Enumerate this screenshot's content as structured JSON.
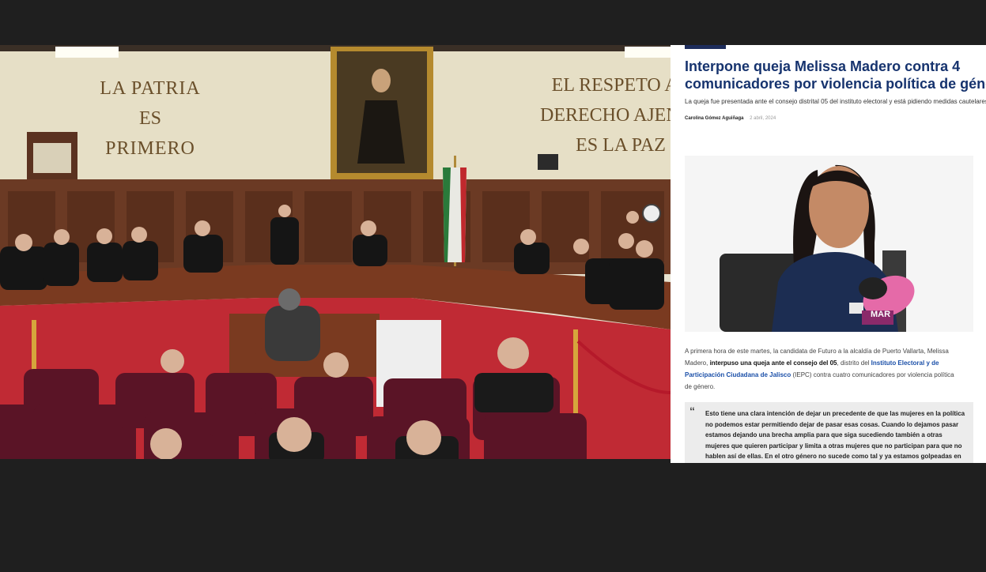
{
  "courtroom_image": {
    "wall_left": [
      "LA PATRIA",
      "ES",
      "PRIMERO"
    ],
    "wall_right": [
      "EL RESPETO AL",
      "DERECHO AJENO",
      "ES LA PAZ"
    ]
  },
  "article": {
    "headline_line1": "Interpone queja Melissa Madero contra 4",
    "headline_line2": "comunicadores por violencia política de género",
    "subtitle": "La queja fue presentada ante el consejo distrital 05 del instituto electoral y está pidiendo medidas cautelares",
    "author": "Carolina Gómez Aguiñaga",
    "date": "2 abril, 2024",
    "photo": {
      "mic_label": "MAR"
    },
    "body": {
      "p1": "A primera hora de este martes, la candidata de Futuro a la alcaldía de Puerto Vallarta, Melissa Madero, ",
      "p1_bold": "interpuso una queja ante el consejo del 05",
      "p1_mid": ", distrito del ",
      "p1_link": "Instituto Electoral y de Participación Ciudadana de Jalisco",
      "p1_end": " (IEPC) contra cuatro comunicadores por violencia política de género."
    },
    "quote": {
      "mark": "“",
      "text": "Esto tiene una clara intención de dejar un precedente de que las mujeres en la política no podemos estar permitiendo dejar de pasar esas cosas. Cuando lo dejamos pasar estamos dejando una brecha amplia para que siga sucediendo también a otras mujeres que quieren participar y limita a otras mujeres que no participan para que no hablen así de ellas. En el otro género no sucede como tal y ya estamos golpeadas en"
    }
  }
}
